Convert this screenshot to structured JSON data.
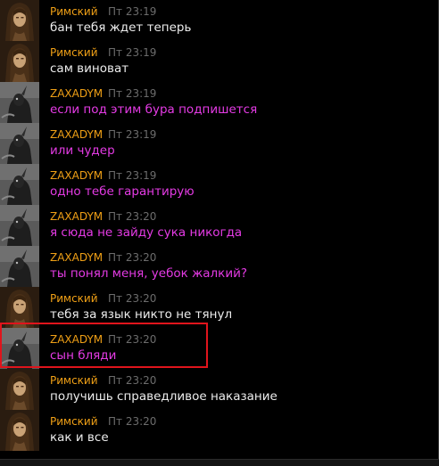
{
  "colors": {
    "author": "#f0a016",
    "timestamp": "#6c6c6c",
    "text_white": "#ececec",
    "text_magenta": "#e53be5",
    "highlight": "#e0141c"
  },
  "avatars": {
    "rimsky": "long-haired-warrior-avatar-icon",
    "zaxadym": "grey-creature-avatar-icon"
  },
  "messages": [
    {
      "author": "Римский",
      "avatar": "rimsky",
      "time": "Пт 23:19",
      "text": "бан тебя ждет теперь",
      "color": "white"
    },
    {
      "author": "Римский",
      "avatar": "rimsky",
      "time": "Пт 23:19",
      "text": "сам виноват",
      "color": "white"
    },
    {
      "author": "ZAXADYM",
      "avatar": "zaxadym",
      "time": "Пт 23:19",
      "text": "если под этим бура подпишется",
      "color": "magenta"
    },
    {
      "author": "ZAXADYM",
      "avatar": "zaxadym",
      "time": "Пт 23:19",
      "text": "или чудер",
      "color": "magenta"
    },
    {
      "author": "ZAXADYM",
      "avatar": "zaxadym",
      "time": "Пт 23:19",
      "text": "одно тебе гарантирую",
      "color": "magenta"
    },
    {
      "author": "ZAXADYM",
      "avatar": "zaxadym",
      "time": "Пт 23:20",
      "text": "я сюда не зайду сука никогда",
      "color": "magenta"
    },
    {
      "author": "ZAXADYM",
      "avatar": "zaxadym",
      "time": "Пт 23:20",
      "text": "ты понял меня, уебок жалкий?",
      "color": "magenta"
    },
    {
      "author": "Римский",
      "avatar": "rimsky",
      "time": "Пт 23:20",
      "text": "тебя за язык никто не тянул",
      "color": "white"
    },
    {
      "author": "ZAXADYM",
      "avatar": "zaxadym",
      "time": "Пт 23:20",
      "text": "сын бляди",
      "color": "magenta"
    },
    {
      "author": "Римский",
      "avatar": "rimsky",
      "time": "Пт 23:20",
      "text": "получишь справедливое наказание",
      "color": "white"
    },
    {
      "author": "Римский",
      "avatar": "rimsky",
      "time": "Пт 23:20",
      "text": "как и все",
      "color": "white"
    }
  ]
}
